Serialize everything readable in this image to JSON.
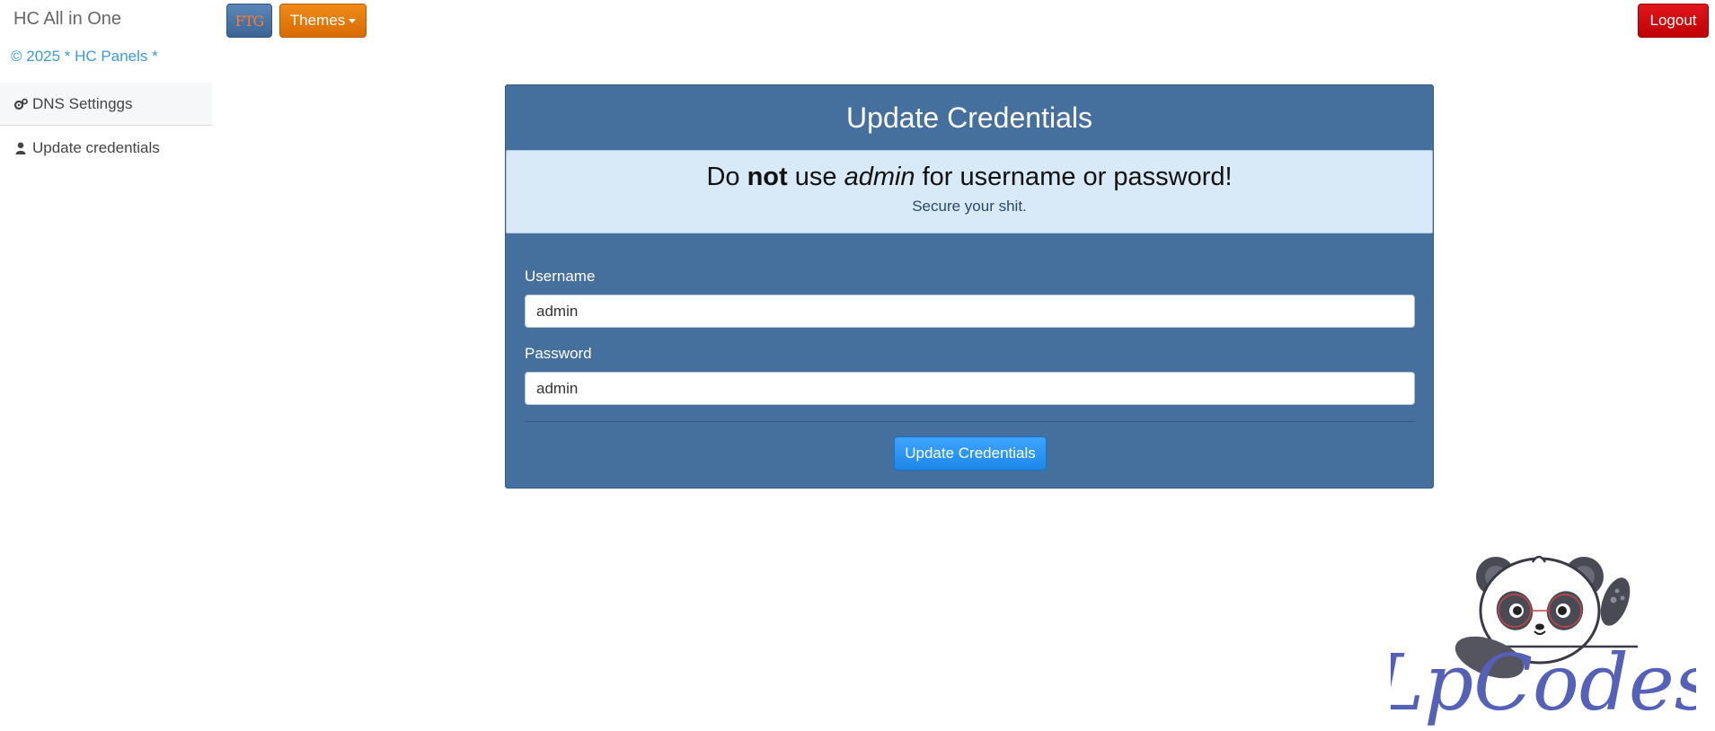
{
  "sidebar": {
    "brand": "HC All in One",
    "copyright": "© 2025 * HC Panels *",
    "items": [
      {
        "label": "DNS Settinggs",
        "icon": "gears-icon"
      },
      {
        "label": "Update credentials",
        "icon": "user-icon"
      }
    ]
  },
  "topbar": {
    "ftg_label": "FTG",
    "themes_label": "Themes",
    "logout_label": "Logout"
  },
  "panel": {
    "title": "Update Credentials",
    "alert": {
      "prefix": "Do ",
      "bold": "not",
      "middle": " use ",
      "italic": "admin",
      "suffix": " for username or password!",
      "subtitle": "Secure your shit."
    },
    "username_label": "Username",
    "username_value": "admin",
    "password_label": "Password",
    "password_value": "admin",
    "submit_label": "Update Credentials"
  },
  "logo": {
    "text": "LpCodes"
  },
  "colors": {
    "panel": "#456f9c",
    "alert_bg": "#d8eaf8",
    "themes_button": "#e07a0a",
    "logout_button": "#d60d12",
    "submit_button": "#2f9af5",
    "link": "#3a9ad9"
  }
}
